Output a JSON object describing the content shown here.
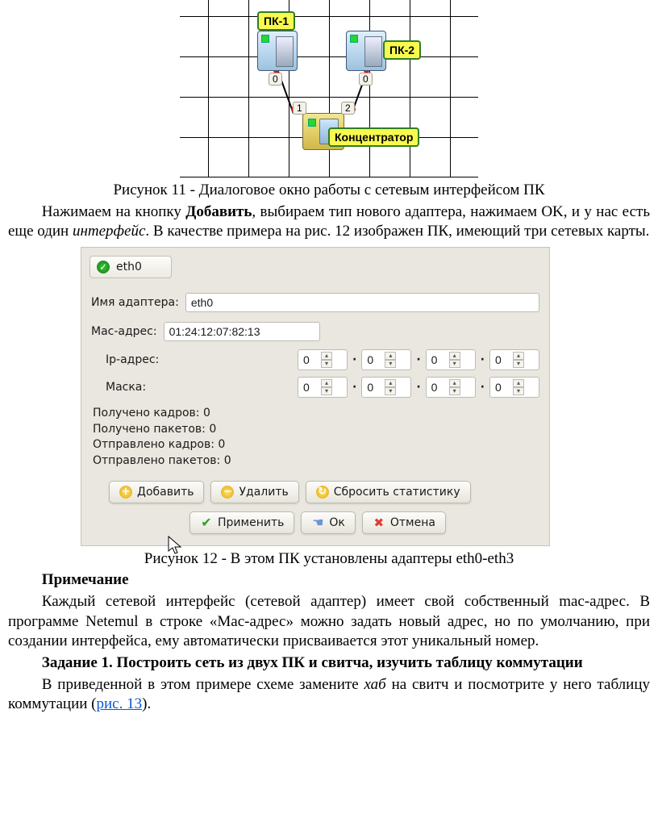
{
  "fig11": {
    "pc1_label": "ПК-1",
    "pc2_label": "ПК-2",
    "hub_label": "Концентратор",
    "port0a": "0",
    "port0b": "0",
    "port1": "1",
    "port2": "2",
    "caption": "Рисунок 11 - Диалоговое окно работы с сетевым интерфейсом ПК"
  },
  "para1_a": "Нажимаем на кнопку ",
  "para1_b": "Добавить",
  "para1_c": ", выбираем тип нового адаптера, нажимаем OK, и у нас есть еще один ",
  "para1_d": "интерфейс",
  "para1_e": ". В качестве примера на рис. 12 изображен ПК, имеющий три сетевых карты.",
  "dlg": {
    "tab_label": "eth0",
    "lbl_adapter": "Имя адаптера:",
    "val_adapter": "eth0",
    "lbl_mac": "Mac-адрес:",
    "val_mac": "01:24:12:07:82:13",
    "lbl_ip": "Ip-адрес:",
    "lbl_mask": "Маска:",
    "ip": [
      "0",
      "0",
      "0",
      "0"
    ],
    "mask": [
      "0",
      "0",
      "0",
      "0"
    ],
    "stat_rx_frames": "Получено кадров: 0",
    "stat_rx_packets": "Получено пакетов: 0",
    "stat_tx_frames": "Отправлено кадров: 0",
    "stat_tx_packets": "Отправлено пакетов: 0",
    "btn_add": "Добавить",
    "btn_del": "Удалить",
    "btn_reset": "Сбросить статистику",
    "btn_apply": "Применить",
    "btn_ok": "Ок",
    "btn_cancel": "Отмена",
    "caption": "Рисунок 12 - В этом ПК установлены адаптеры eth0-eth3"
  },
  "note_h": "Примечание",
  "note_body": "Каждый сетевой интерфейс (сетевой адаптер) имеет свой собственный mac-адрес. В программе Netemul в строке «Mac-адрес» можно задать новый адрес, но по умолчанию, при создании интерфейса, ему автоматически присваивается этот уникальный номер.",
  "task_h": "Задание 1. Построить сеть из двух ПК и свитча, изучить таблицу коммутации",
  "task_a": "В приведенной в этом примере схеме замените ",
  "task_b": "хаб ",
  "task_c": "на свитч и посмотрите у него таблицу коммутации (",
  "task_link": "рис. 13",
  "task_d": ")."
}
